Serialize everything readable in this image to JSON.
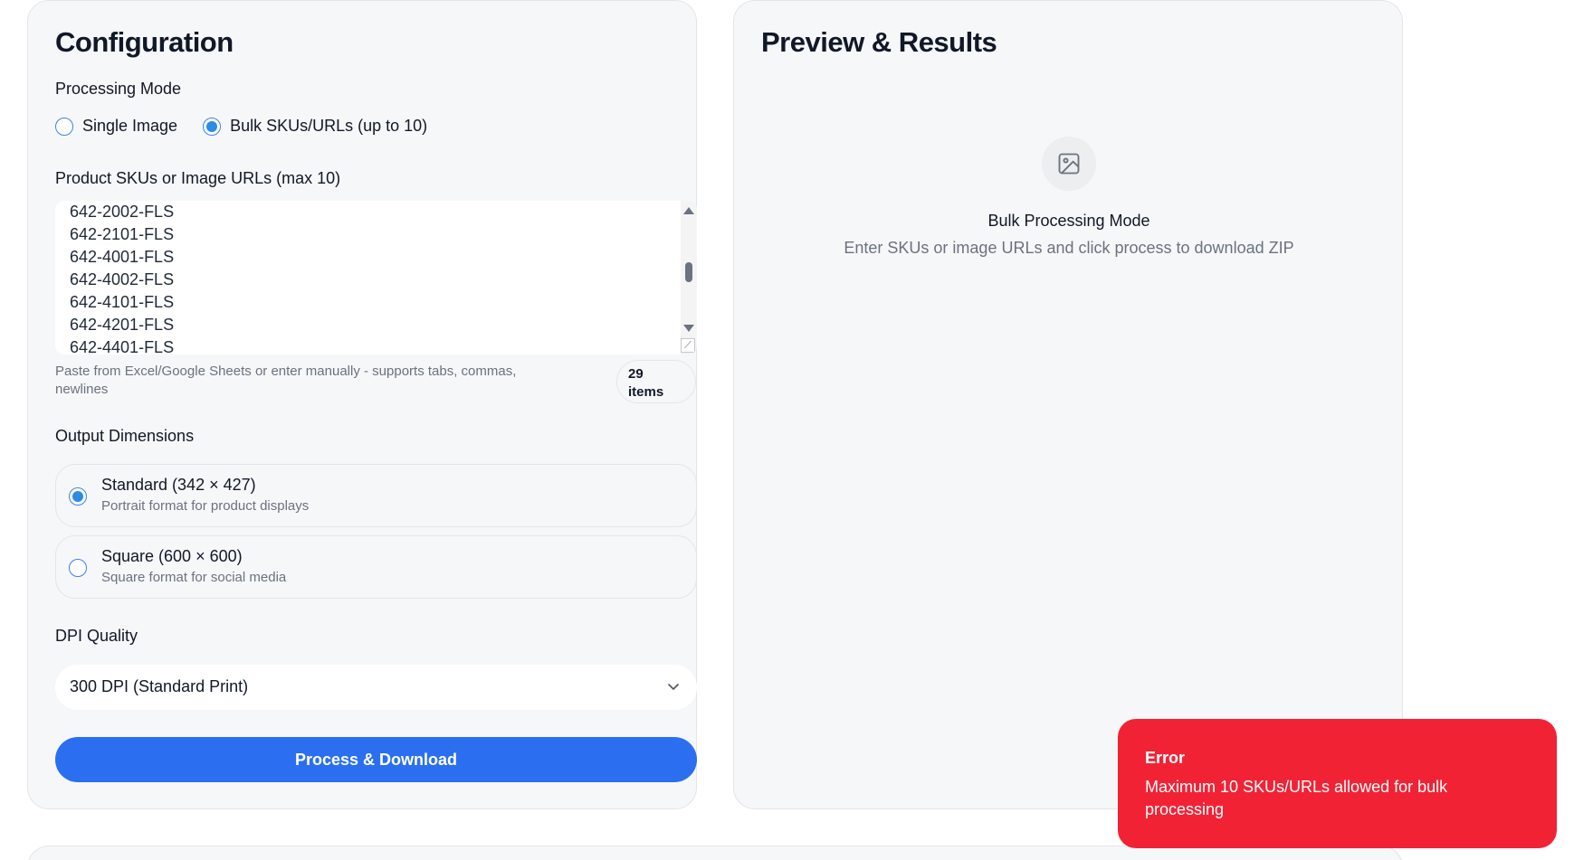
{
  "config": {
    "title": "Configuration",
    "processing_mode": {
      "label": "Processing Mode",
      "options": [
        {
          "label": "Single Image",
          "selected": false
        },
        {
          "label": "Bulk SKUs/URLs (up to 10)",
          "selected": true
        }
      ]
    },
    "skus": {
      "label": "Product SKUs or Image URLs (max 10)",
      "visible_lines": [
        "642-2002-FLS",
        "642-2101-FLS",
        "642-4001-FLS",
        "642-4002-FLS",
        "642-4101-FLS",
        "642-4201-FLS",
        "642-4401-FLS"
      ],
      "hint": "Paste from Excel/Google Sheets or enter manually - supports tabs, commas, newlines",
      "count": "29",
      "count_unit": "items"
    },
    "output_dimensions": {
      "label": "Output Dimensions",
      "options": [
        {
          "title": "Standard (342 × 427)",
          "subtitle": "Portrait format for product displays",
          "selected": true
        },
        {
          "title": "Square (600 × 600)",
          "subtitle": "Square format for social media",
          "selected": false
        }
      ]
    },
    "dpi": {
      "label": "DPI Quality",
      "selected": "300 DPI (Standard Print)"
    },
    "process_button": "Process & Download"
  },
  "preview": {
    "title": "Preview & Results",
    "empty_title": "Bulk Processing Mode",
    "empty_subtitle": "Enter SKUs or image URLs and click process to download ZIP",
    "icon": "image-icon"
  },
  "toast": {
    "title": "Error",
    "message": "Maximum 10 SKUs/URLs allowed for bulk processing",
    "color": "#f22235"
  },
  "colors": {
    "accent": "#2b6ff0",
    "radio": "#2b8be8",
    "error": "#f22235"
  }
}
